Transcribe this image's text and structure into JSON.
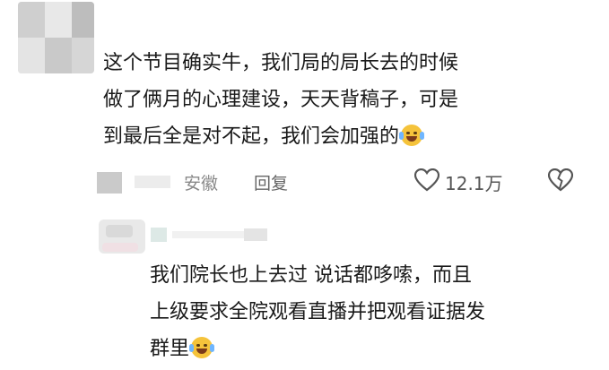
{
  "comments": [
    {
      "lines": [
        "这个节目确实牛，我们局的局长去的时候",
        "做了俩月的心理建设，天天背稿子，可是",
        "到最后全是对不起，我们会加强的"
      ],
      "trailing_emoji": "laughing-tears-emoji",
      "location": "安徽",
      "reply_label": "回复",
      "like_count": "12.1万"
    },
    {
      "lines": [
        "我们院长也上去过 说话都哆嗦，而且",
        "上级要求全院观看直播并把观看证据发",
        "群里"
      ],
      "trailing_emoji": "laughing-tears-emoji"
    }
  ],
  "colors": {
    "text": "#1a1a1a",
    "meta": "#888888",
    "emoji": "#f5c33b"
  }
}
